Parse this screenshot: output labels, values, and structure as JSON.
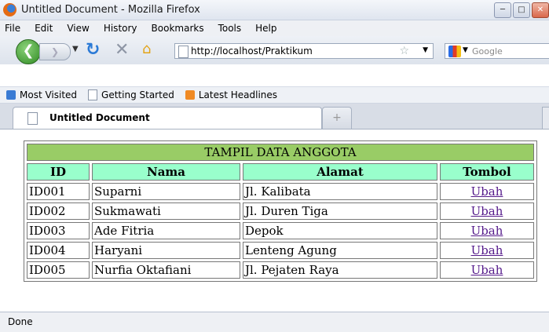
{
  "window": {
    "title": "Untitled Document - Mozilla Firefox",
    "controls": [
      "minimize-icon",
      "maximize-icon",
      "close-icon"
    ]
  },
  "menu": [
    "File",
    "Edit",
    "View",
    "History",
    "Bookmarks",
    "Tools",
    "Help"
  ],
  "nav": {
    "url": "http://localhost/Praktikum",
    "search_placeholder": "Google"
  },
  "bookmarks": [
    "Most Visited",
    "Getting Started",
    "Latest Headlines"
  ],
  "tab": {
    "label": "Untitled Document"
  },
  "table": {
    "caption": "TAMPIL DATA ANGGOTA",
    "headers": [
      "ID",
      "Nama",
      "Alamat",
      "Tombol"
    ],
    "rows": [
      {
        "id": "ID001",
        "nama": "Suparni",
        "alamat": "Jl. Kalibata",
        "tombol": "Ubah"
      },
      {
        "id": "ID002",
        "nama": "Sukmawati",
        "alamat": "Jl. Duren Tiga",
        "tombol": "Ubah"
      },
      {
        "id": "ID003",
        "nama": "Ade Fitria",
        "alamat": "Depok",
        "tombol": "Ubah"
      },
      {
        "id": "ID004",
        "nama": "Haryani",
        "alamat": "Lenteng Agung",
        "tombol": "Ubah"
      },
      {
        "id": "ID005",
        "nama": "Nurfia Oktafiani",
        "alamat": "Jl. Pejaten Raya",
        "tombol": "Ubah"
      }
    ]
  },
  "status": "Done",
  "colors": {
    "caption_bg": "#99cc66",
    "header_bg": "#99ffcc",
    "link": "#551a8b"
  }
}
